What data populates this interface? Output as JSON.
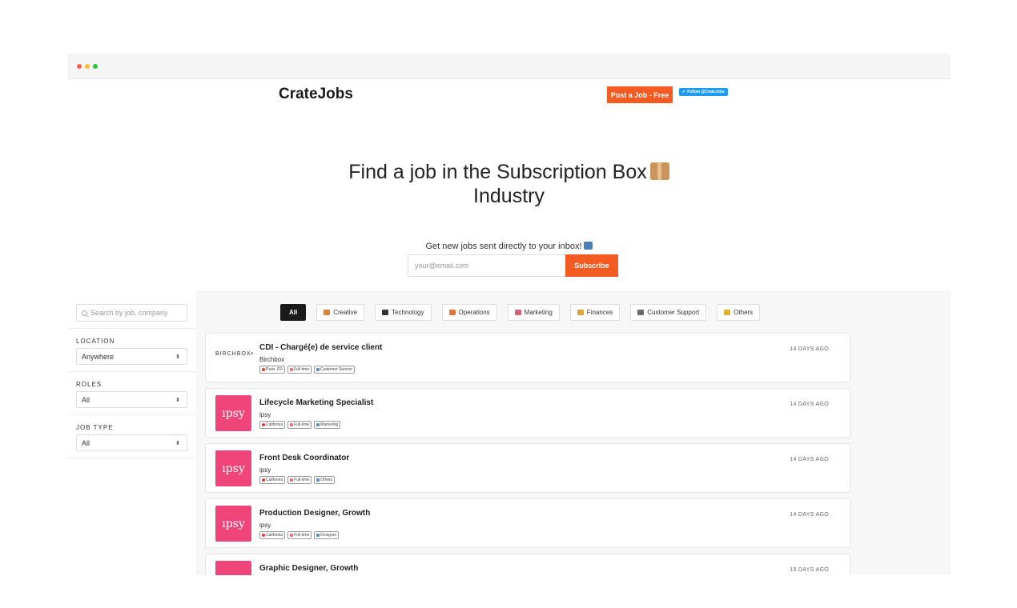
{
  "header": {
    "brand": "CrateJobs",
    "post_job": "Post a Job - Free",
    "follow": "Follow @CrateJobs"
  },
  "hero": {
    "line1": "Find a job in the Subscription Box",
    "line2": "Industry"
  },
  "newsletter": {
    "label": "Get new jobs sent directly to your inbox!",
    "placeholder": "your@email.com",
    "subscribe": "Subscribe"
  },
  "sidebar": {
    "search_placeholder": "Search by job, company",
    "location_label": "LOCATION",
    "location_value": "Anywhere",
    "roles_label": "ROLES",
    "roles_value": "All",
    "jobtype_label": "JOB TYPE",
    "jobtype_value": "All"
  },
  "categories": [
    "All",
    "Creative",
    "Technology",
    "Operations",
    "Marketing",
    "Finances",
    "Customer Support",
    "Others"
  ],
  "category_colors": [
    "",
    "#d9843b",
    "#333333",
    "#e0763a",
    "#d95f7a",
    "#d9a53b",
    "#6a6a6a",
    "#e3b02c"
  ],
  "jobs": [
    {
      "title": "CDI - Chargé(e) de service client",
      "company": "Birchbox",
      "logo": "BIRCHBOX•",
      "location": "Paris, FR",
      "type": "Full-time",
      "role": "Customer Service",
      "date": "14 DAYS AGO"
    },
    {
      "title": "Lifecycle Marketing Specialist",
      "company": "ipsy",
      "logo": "ıpsy",
      "location": "California",
      "type": "Full-time",
      "role": "Marketing",
      "date": "14 DAYS AGO"
    },
    {
      "title": "Front Desk Coordinator",
      "company": "ipsy",
      "logo": "ıpsy",
      "location": "California",
      "type": "Full-time",
      "role": "Others",
      "date": "14 DAYS AGO"
    },
    {
      "title": "Production Designer, Growth",
      "company": "ipsy",
      "logo": "ıpsy",
      "location": "California",
      "type": "Full-time",
      "role": "Designer",
      "date": "14 DAYS AGO"
    },
    {
      "title": "Graphic Designer, Growth",
      "company": "",
      "logo": "",
      "location": "",
      "type": "",
      "role": "",
      "date": "15 DAYS AGO"
    }
  ]
}
